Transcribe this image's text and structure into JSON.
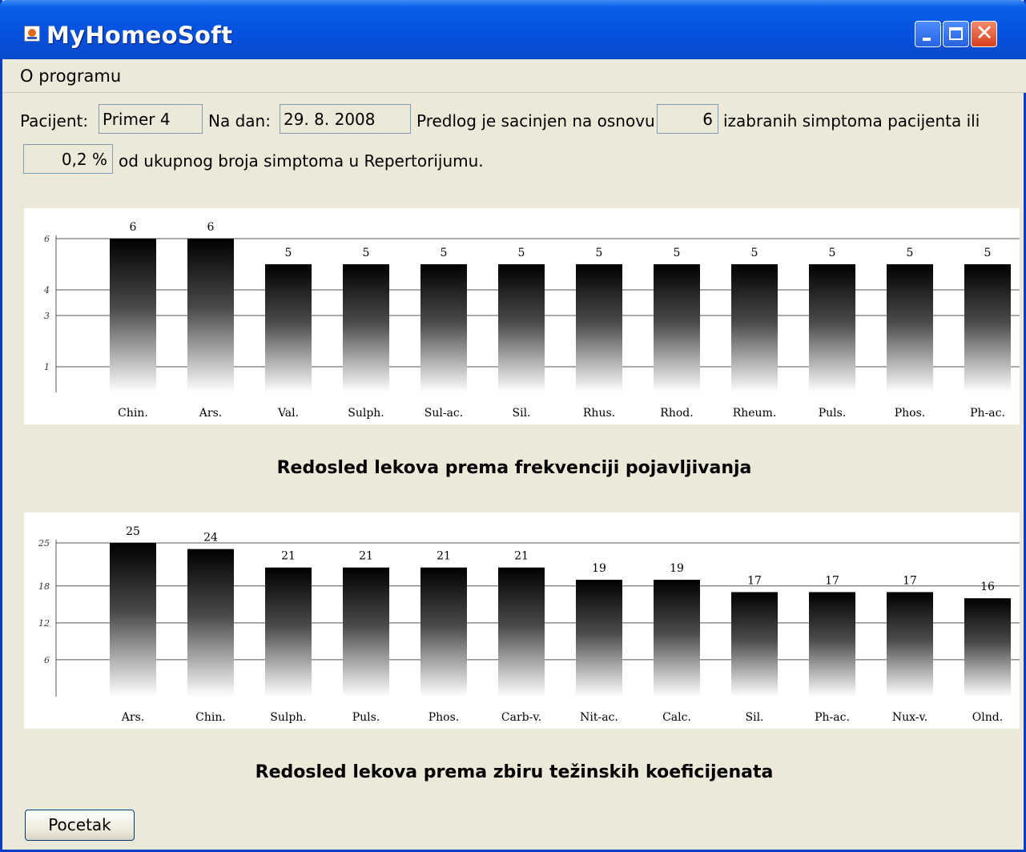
{
  "window": {
    "title": "MyHomeoSoft"
  },
  "menu": {
    "items": [
      "O programu"
    ]
  },
  "form": {
    "patient_label": "Pacijent:",
    "patient_value": "Primer 4",
    "date_label": "Na dan:",
    "date_value": "29. 8. 2008",
    "basis_label": "Predlog je sacinjen na osnovu",
    "symptom_count": "6",
    "symptom_suffix": "izabranih simptoma pacijenta ili",
    "percent_value": "0,2 %",
    "percent_suffix": "od ukupnog broja simptoma u Repertorijumu."
  },
  "chart_data": [
    {
      "type": "bar",
      "title": "Redosled lekova prema frekvenciji pojavljivanja",
      "categories": [
        "Chin.",
        "Ars.",
        "Val.",
        "Sulph.",
        "Sul-ac.",
        "Sil.",
        "Rhus.",
        "Rhod.",
        "Rheum.",
        "Puls.",
        "Phos.",
        "Ph-ac."
      ],
      "values": [
        6,
        6,
        5,
        5,
        5,
        5,
        5,
        5,
        5,
        5,
        5,
        5
      ],
      "yticks": [
        1,
        3,
        4,
        6
      ],
      "ylim": [
        0,
        6
      ],
      "grid": true,
      "data_labels": true
    },
    {
      "type": "bar",
      "title": "Redosled lekova prema zbiru težinskih koeficijenata",
      "categories": [
        "Ars.",
        "Chin.",
        "Sulph.",
        "Puls.",
        "Phos.",
        "Carb-v.",
        "Nit-ac.",
        "Calc.",
        "Sil.",
        "Ph-ac.",
        "Nux-v.",
        "Olnd."
      ],
      "values": [
        25,
        24,
        21,
        21,
        21,
        21,
        19,
        19,
        17,
        17,
        17,
        16
      ],
      "yticks": [
        6,
        12,
        18,
        25
      ],
      "ylim": [
        0,
        25
      ],
      "grid": true,
      "data_labels": true
    }
  ],
  "buttons": {
    "start": "Pocetak"
  }
}
